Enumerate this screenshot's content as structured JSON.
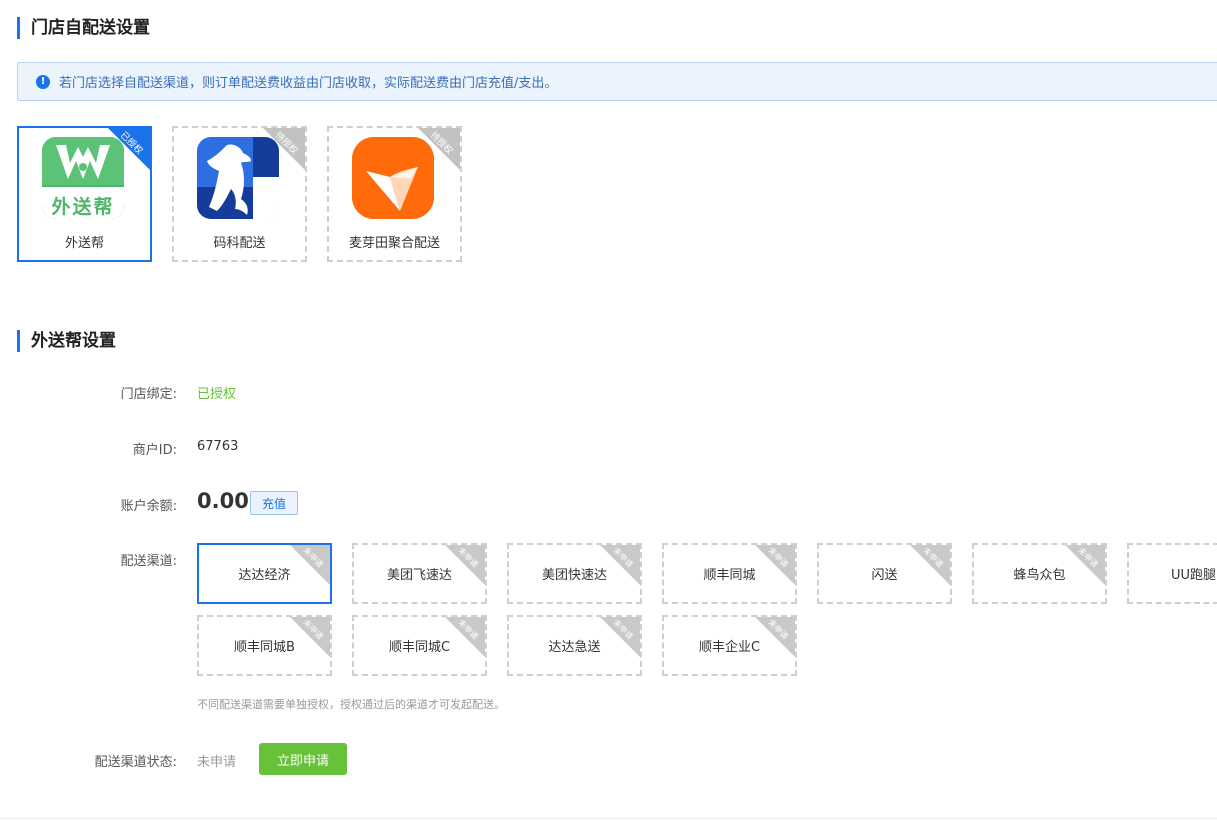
{
  "section1": {
    "title": "门店自配送设置"
  },
  "notice": {
    "icon": "info-icon",
    "text": "若门店选择自配送渠道，则订单配送费收益由门店收取，实际配送费由门店充值/支出。"
  },
  "platforms": [
    {
      "name": "外送帮",
      "badge": "已授权",
      "logo_text": "外送帮",
      "selected": true
    },
    {
      "name": "码科配送",
      "badge": "待授权",
      "selected": false
    },
    {
      "name": "麦芽田聚合配送",
      "badge": "待授权",
      "selected": false
    }
  ],
  "section2": {
    "title": "外送帮设置"
  },
  "form": {
    "binding": {
      "label": "门店绑定:",
      "value": "已授权"
    },
    "merchant_id": {
      "label": "商户ID:",
      "value": "67763"
    },
    "balance": {
      "label": "账户余额:",
      "value": "0.00",
      "recharge_label": "充值"
    },
    "channels": {
      "label": "配送渠道:",
      "items": [
        {
          "name": "达达经济",
          "badge": "未申请"
        },
        {
          "name": "美团飞速达",
          "badge": "未申请"
        },
        {
          "name": "美团快速达",
          "badge": "未申请"
        },
        {
          "name": "顺丰同城",
          "badge": "未申请"
        },
        {
          "name": "闪送",
          "badge": "未申请"
        },
        {
          "name": "蜂鸟众包",
          "badge": "未申请"
        },
        {
          "name": "UU跑腿",
          "badge": "未申请"
        },
        {
          "name": "顺丰同城B",
          "badge": "未申请"
        },
        {
          "name": "顺丰同城C",
          "badge": "未申请"
        },
        {
          "name": "达达急送",
          "badge": "未申请"
        },
        {
          "name": "顺丰企业C",
          "badge": "未申请"
        }
      ],
      "hint": "不同配送渠道需要单独授权，授权通过后的渠道才可发起配送。"
    },
    "channel_status": {
      "label": "配送渠道状态:",
      "value": "未申请",
      "apply_label": "立即申请"
    }
  },
  "colors": {
    "accent": "#1a73e8",
    "success": "#67c23a",
    "badge_gray": "#c2c2c2"
  }
}
